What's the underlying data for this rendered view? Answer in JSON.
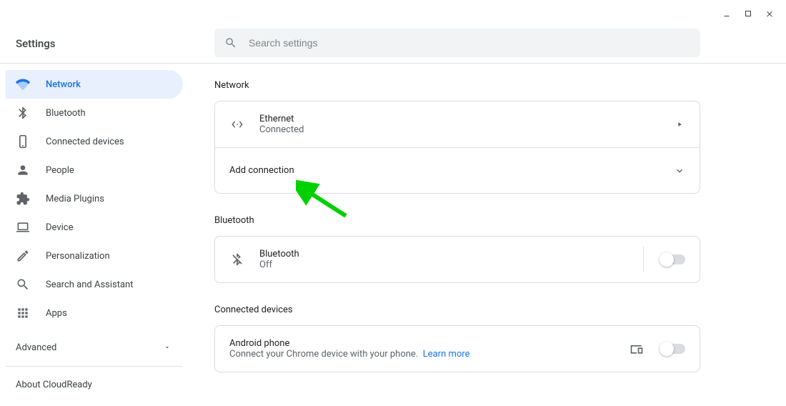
{
  "window": {
    "minimize": "–",
    "maximize": "▢",
    "close": "✕"
  },
  "settings_title": "Settings",
  "search": {
    "placeholder": "Search settings"
  },
  "sidebar": {
    "items": [
      {
        "label": "Network",
        "icon": "wifi-icon"
      },
      {
        "label": "Bluetooth",
        "icon": "bluetooth-icon"
      },
      {
        "label": "Connected devices",
        "icon": "phone-icon"
      },
      {
        "label": "People",
        "icon": "person-icon"
      },
      {
        "label": "Media Plugins",
        "icon": "extension-icon"
      },
      {
        "label": "Device",
        "icon": "laptop-icon"
      },
      {
        "label": "Personalization",
        "icon": "brush-icon"
      },
      {
        "label": "Search and Assistant",
        "icon": "search-icon"
      },
      {
        "label": "Apps",
        "icon": "apps-icon"
      }
    ],
    "advanced": "Advanced",
    "about": "About CloudReady"
  },
  "sections": {
    "network": {
      "heading": "Network",
      "ethernet": {
        "title": "Ethernet",
        "status": "Connected"
      },
      "add_connection": "Add connection"
    },
    "bluetooth": {
      "heading": "Bluetooth",
      "title": "Bluetooth",
      "status": "Off"
    },
    "connected": {
      "heading": "Connected devices",
      "title": "Android phone",
      "subtitle": "Connect your Chrome device with your phone.",
      "learn_more": "Learn more"
    }
  }
}
